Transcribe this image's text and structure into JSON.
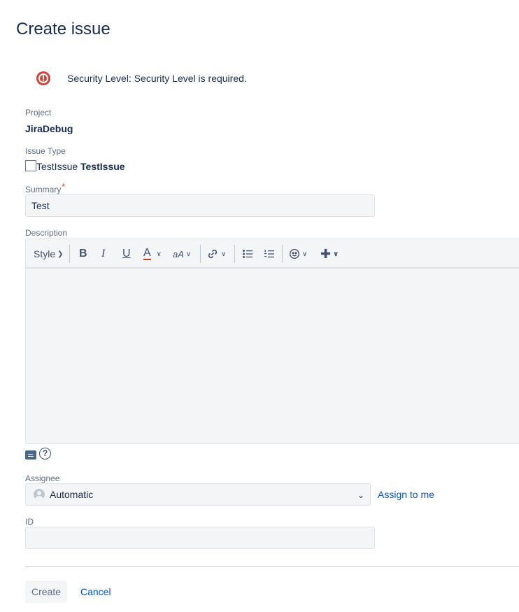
{
  "page": {
    "title": "Create issue"
  },
  "error": {
    "message": "Security Level: Security Level is required."
  },
  "project": {
    "label": "Project",
    "value": "JiraDebug"
  },
  "issue_type": {
    "label": "Issue Type",
    "alt_text": "TestIssue",
    "value": "TestIssue"
  },
  "summary": {
    "label": "Summary",
    "required_mark": "*",
    "value": "Test"
  },
  "description": {
    "label": "Description",
    "toolbar": {
      "style_label": "Style",
      "bold": "B",
      "italic": "I",
      "underline": "U",
      "text_color": "A",
      "text_size": "aA"
    }
  },
  "assignee": {
    "label": "Assignee",
    "selected": "Automatic",
    "assign_to_me": "Assign to me"
  },
  "id_field": {
    "label": "ID",
    "value": ""
  },
  "footer": {
    "create_label": "Create",
    "cancel_label": "Cancel"
  },
  "colors": {
    "error": "#de350b",
    "error_icon": "#d04437",
    "link": "#0052cc",
    "text_primary": "#172b4d",
    "text_label": "#5e6c84",
    "field_bg": "#f4f5f7"
  }
}
